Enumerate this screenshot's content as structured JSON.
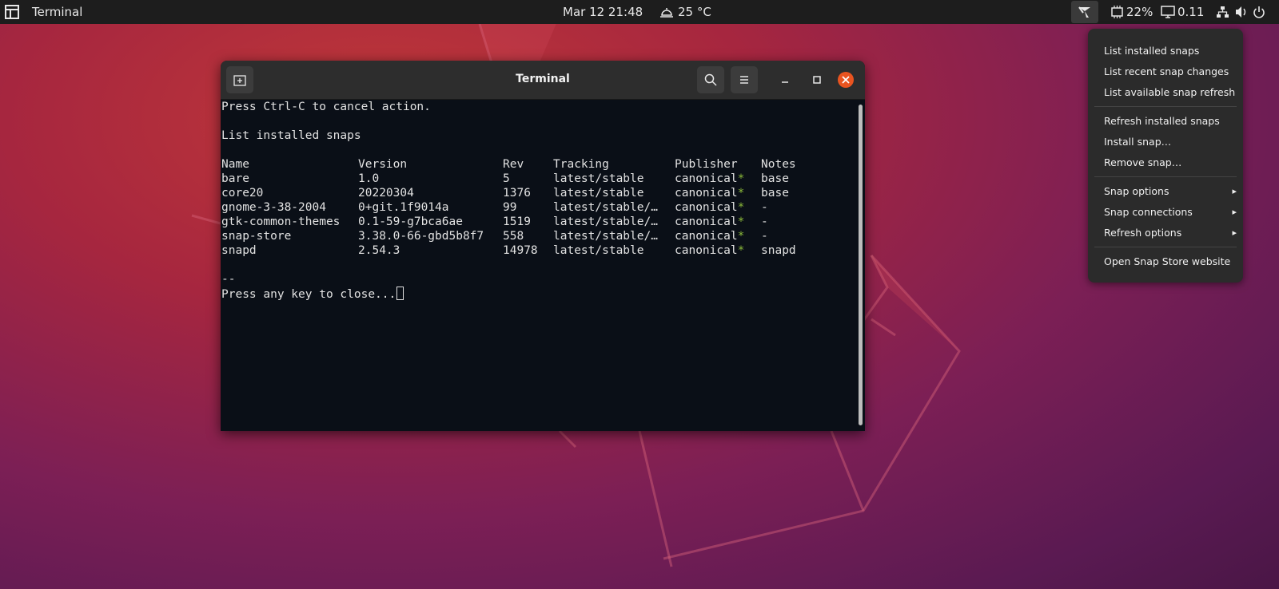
{
  "topbar": {
    "app_name": "Terminal",
    "clock": "Mar 12  21:48",
    "weather": "25 °C",
    "cpu": "22%",
    "load": "0.11"
  },
  "snap_menu": {
    "items": [
      {
        "label": "List installed snaps",
        "submenu": false
      },
      {
        "label": "List recent snap changes",
        "submenu": false
      },
      {
        "label": "List available snap refresh",
        "submenu": false
      },
      {
        "label": "Refresh installed snaps",
        "submenu": false
      },
      {
        "label": "Install snap…",
        "submenu": false
      },
      {
        "label": "Remove snap…",
        "submenu": false
      },
      {
        "label": "Snap options",
        "submenu": true
      },
      {
        "label": "Snap connections",
        "submenu": true
      },
      {
        "label": "Refresh options",
        "submenu": true
      },
      {
        "label": "Open Snap Store website",
        "submenu": false
      }
    ],
    "arrow": "▸"
  },
  "terminal": {
    "title": "Terminal",
    "line_cancel": "Press Ctrl-C to cancel action.",
    "line_heading": "List installed snaps",
    "columns": [
      "Name",
      "Version",
      "Rev",
      "Tracking",
      "Publisher",
      "Notes"
    ],
    "rows": [
      [
        "bare",
        "1.0",
        "5",
        "latest/stable",
        "canonical",
        "base"
      ],
      [
        "core20",
        "20220304",
        "1376",
        "latest/stable",
        "canonical",
        "base"
      ],
      [
        "gnome-3-38-2004",
        "0+git.1f9014a",
        "99",
        "latest/stable/…",
        "canonical",
        "-"
      ],
      [
        "gtk-common-themes",
        "0.1-59-g7bca6ae",
        "1519",
        "latest/stable/…",
        "canonical",
        "-"
      ],
      [
        "snap-store",
        "3.38.0-66-gbd5b8f7",
        "558",
        "latest/stable/…",
        "canonical",
        "-"
      ],
      [
        "snapd",
        "2.54.3",
        "14978",
        "latest/stable",
        "canonical",
        "snapd"
      ]
    ],
    "publisher_mark": "*",
    "line_separator": "--",
    "line_close": "Press any key to close..."
  },
  "colors": {
    "accent": "#e95420",
    "publisher_mark": "#8ab83a",
    "topbar": "#1d1d1d",
    "terminal_bg": "#0a0f17"
  }
}
